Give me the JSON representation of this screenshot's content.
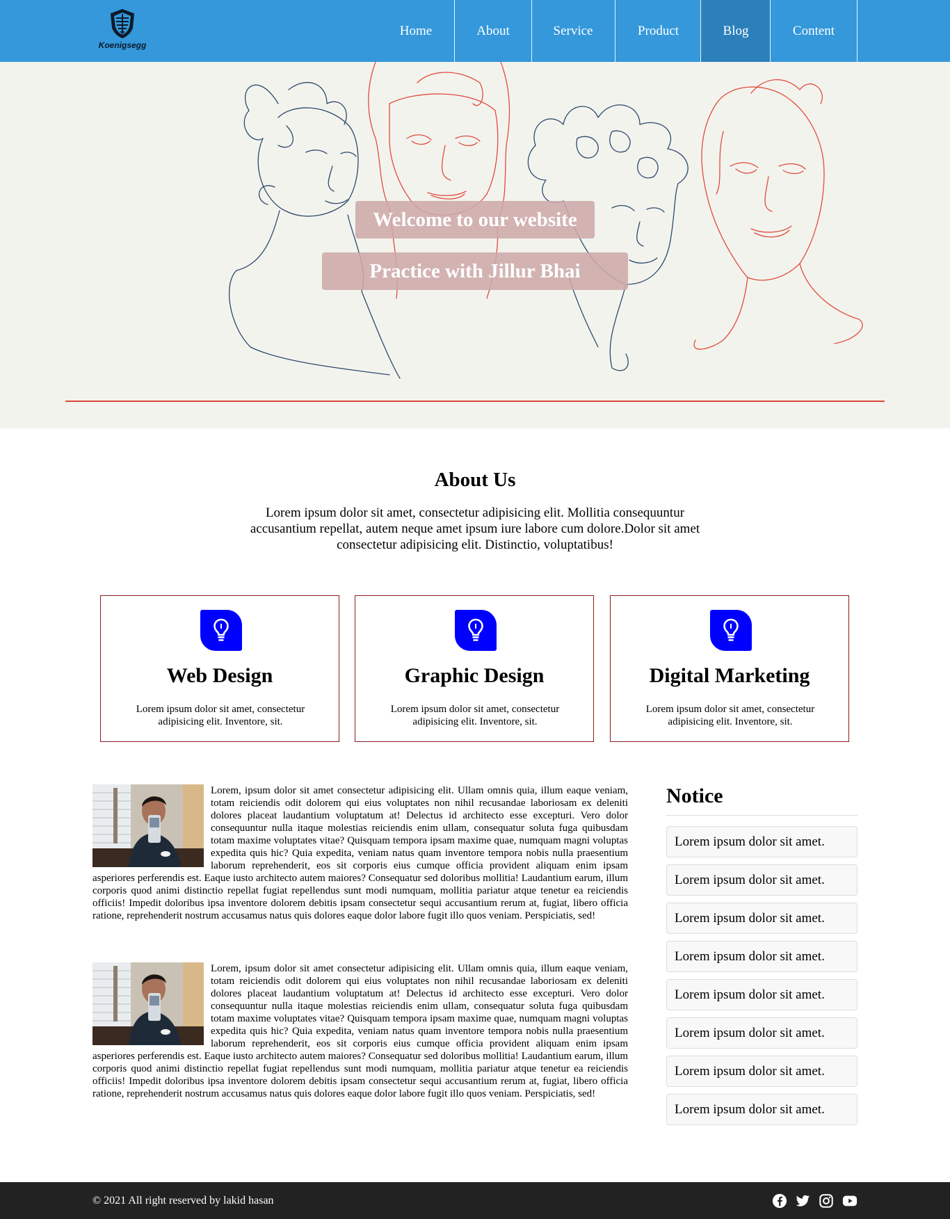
{
  "brand": {
    "name": "Koenigsegg"
  },
  "nav": {
    "items": [
      "Home",
      "About",
      "Service",
      "Product",
      "Blog",
      "Content"
    ],
    "active": "Blog"
  },
  "hero": {
    "title": "Welcome to our website",
    "subtitle": "Practice with Jillur Bhai"
  },
  "about": {
    "title": "About Us",
    "text": "Lorem ipsum dolor sit amet, consectetur adipisicing elit. Mollitia consequuntur accusantium repellat, autem neque amet ipsum iure labore cum dolore.Dolor sit amet consectetur adipisicing elit. Distinctio, voluptatibus!"
  },
  "services": [
    {
      "icon": "lightbulb-icon",
      "title": "Web Design",
      "text": "Lorem ipsum dolor sit amet, consectetur adipisicing elit. Inventore, sit."
    },
    {
      "icon": "lightbulb-icon",
      "title": "Graphic Design",
      "text": "Lorem ipsum dolor sit amet, consectetur adipisicing elit. Inventore, sit."
    },
    {
      "icon": "lightbulb-icon",
      "title": "Digital Marketing",
      "text": "Lorem ipsum dolor sit amet, consectetur adipisicing elit. Inventore, sit."
    }
  ],
  "articles": [
    {
      "text": "Lorem, ipsum dolor sit amet consectetur adipisicing elit. Ullam omnis quia, illum eaque veniam, totam reiciendis odit dolorem qui eius voluptates non nihil recusandae laboriosam ex deleniti dolores placeat laudantium voluptatum at! Delectus id architecto esse excepturi. Vero dolor consequuntur nulla itaque molestias reiciendis enim ullam, consequatur soluta fuga quibusdam totam maxime voluptates vitae? Quisquam tempora ipsam maxime quae, numquam magni voluptas expedita quis hic? Quia expedita, veniam natus quam inventore tempora nobis nulla praesentium laborum reprehenderit, eos sit corporis eius cumque officia provident aliquam enim ipsam asperiores perferendis est. Eaque iusto architecto autem maiores? Consequatur sed doloribus mollitia! Laudantium earum, illum corporis quod animi distinctio repellat fugiat repellendus sunt modi numquam, mollitia pariatur atque tenetur ea reiciendis officiis! Impedit doloribus ipsa inventore dolorem debitis ipsam consectetur sequi accusantium rerum at, fugiat, libero officia ratione, reprehenderit nostrum accusamus natus quis dolores eaque dolor labore fugit illo quos veniam. Perspiciatis, sed!"
    },
    {
      "text": "Lorem, ipsum dolor sit amet consectetur adipisicing elit. Ullam omnis quia, illum eaque veniam, totam reiciendis odit dolorem qui eius voluptates non nihil recusandae laboriosam ex deleniti dolores placeat laudantium voluptatum at! Delectus id architecto esse excepturi. Vero dolor consequuntur nulla itaque molestias reiciendis enim ullam, consequatur soluta fuga quibusdam totam maxime voluptates vitae? Quisquam tempora ipsam maxime quae, numquam magni voluptas expedita quis hic? Quia expedita, veniam natus quam inventore tempora nobis nulla praesentium laborum reprehenderit, eos sit corporis eius cumque officia provident aliquam enim ipsam asperiores perferendis est. Eaque iusto architecto autem maiores? Consequatur sed doloribus mollitia! Laudantium earum, illum corporis quod animi distinctio repellat fugiat repellendus sunt modi numquam, mollitia pariatur atque tenetur ea reiciendis officiis! Impedit doloribus ipsa inventore dolorem debitis ipsam consectetur sequi accusantium rerum at, fugiat, libero officia ratione, reprehenderit nostrum accusamus natus quis dolores eaque dolor labore fugit illo quos veniam. Perspiciatis, sed!"
    }
  ],
  "notice": {
    "title": "Notice",
    "items": [
      "Lorem ipsum dolor sit amet.",
      "Lorem ipsum dolor sit amet.",
      "Lorem ipsum dolor sit amet.",
      "Lorem ipsum dolor sit amet.",
      "Lorem ipsum dolor sit amet.",
      "Lorem ipsum dolor sit amet.",
      "Lorem ipsum dolor sit amet.",
      "Lorem ipsum dolor sit amet."
    ]
  },
  "footer": {
    "copyright": "© 2021 All right reserved by lakid hasan",
    "social": [
      "facebook-icon",
      "twitter-icon",
      "instagram-icon",
      "youtube-icon"
    ]
  },
  "colors": {
    "header": "#3498db",
    "nav_active": "#2b80b9",
    "hero_bg": "#f3f3ee",
    "accent_red": "#d9473a",
    "icon_blue": "#0000ff",
    "card_border": "#8b1c1c",
    "footer_bg": "#222222"
  }
}
